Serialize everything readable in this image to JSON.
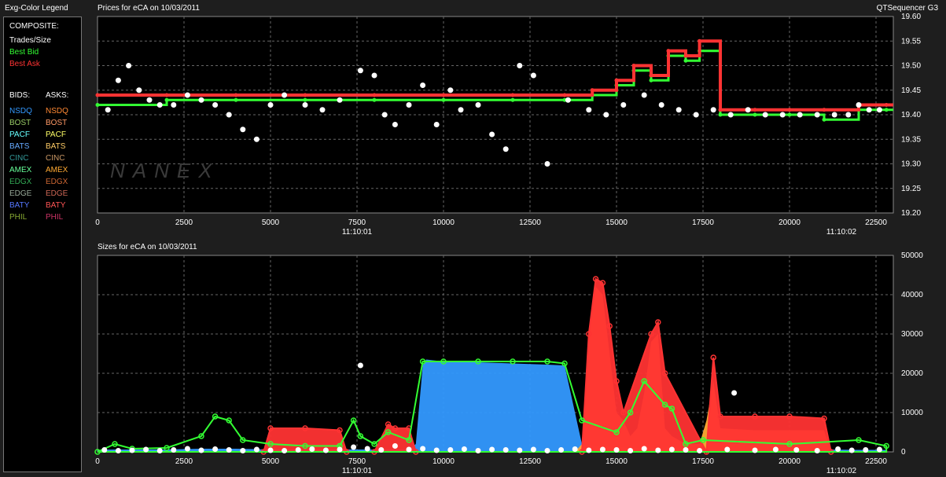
{
  "legend": {
    "title": "Exg-Color Legend",
    "composite_label": "COMPOSITE:",
    "composite": [
      {
        "label": "Trades/Size",
        "color": "#ffffff"
      },
      {
        "label": "Best Bid",
        "color": "#33ff33"
      },
      {
        "label": "Best Ask",
        "color": "#ff3333"
      }
    ],
    "bids_label": "BIDS:",
    "asks_label": "ASKS:",
    "bids": [
      {
        "label": "NSDQ",
        "color": "#3399ff"
      },
      {
        "label": "BOST",
        "color": "#99cc66"
      },
      {
        "label": "PACF",
        "color": "#66ffff"
      },
      {
        "label": "BATS",
        "color": "#66aaff"
      },
      {
        "label": "CINC",
        "color": "#339999"
      },
      {
        "label": "AMEX",
        "color": "#66ff99"
      },
      {
        "label": "EDGX",
        "color": "#33aa55"
      },
      {
        "label": "EDGE",
        "color": "#99aa99"
      },
      {
        "label": "BATY",
        "color": "#5577ff"
      },
      {
        "label": "PHIL",
        "color": "#88aa33"
      }
    ],
    "asks": [
      {
        "label": "NSDQ",
        "color": "#ff8833"
      },
      {
        "label": "BOST",
        "color": "#ff9966"
      },
      {
        "label": "PACF",
        "color": "#ffff66"
      },
      {
        "label": "BATS",
        "color": "#ffcc66"
      },
      {
        "label": "CINC",
        "color": "#cc9966"
      },
      {
        "label": "AMEX",
        "color": "#ffaa33"
      },
      {
        "label": "EDGX",
        "color": "#cc6633"
      },
      {
        "label": "EDGE",
        "color": "#cc6655"
      },
      {
        "label": "BATY",
        "color": "#ff5555"
      },
      {
        "label": "PHIL",
        "color": "#cc3366"
      }
    ]
  },
  "app_title": "QTSequencer G3",
  "watermark": "NANEX",
  "chart_data": [
    {
      "type": "scatter",
      "title": "Prices for  eCA  on 10/03/2011",
      "xlim": [
        0,
        23000
      ],
      "ylim": [
        19.2,
        19.6
      ],
      "x_ticks": [
        0,
        2500,
        5000,
        7500,
        10000,
        12500,
        15000,
        17500,
        20000,
        22500
      ],
      "y_ticks": [
        "19.20",
        "19.25",
        "19.30",
        "19.35",
        "19.40",
        "19.45",
        "19.50",
        "19.55",
        "19.60"
      ],
      "time_labels": [
        {
          "x": 7500,
          "text": "11:10:01"
        },
        {
          "x": 21500,
          "text": "11:10:02"
        }
      ],
      "grid": true,
      "series": [
        {
          "name": "Trades/Size",
          "color": "#ffffff",
          "x": [
            300,
            600,
            900,
            1200,
            1500,
            1800,
            2200,
            2600,
            3000,
            3400,
            3800,
            4200,
            4600,
            5000,
            5400,
            6000,
            6500,
            7000,
            7600,
            8000,
            8300,
            8600,
            9000,
            9400,
            9800,
            10200,
            10500,
            11000,
            11400,
            11800,
            12200,
            12600,
            13000,
            13600,
            14200,
            14700,
            15200,
            15800,
            16300,
            16800,
            17300,
            17800,
            18300,
            18800,
            19300,
            19800,
            20300,
            20800,
            21300,
            21700,
            22000,
            22300,
            22600
          ],
          "y": [
            19.41,
            19.47,
            19.5,
            19.45,
            19.43,
            19.42,
            19.42,
            19.44,
            19.43,
            19.42,
            19.4,
            19.37,
            19.35,
            19.42,
            19.44,
            19.42,
            19.41,
            19.43,
            19.49,
            19.48,
            19.4,
            19.38,
            19.42,
            19.46,
            19.38,
            19.45,
            19.41,
            19.42,
            19.36,
            19.33,
            19.5,
            19.48,
            19.3,
            19.43,
            19.41,
            19.4,
            19.42,
            19.44,
            19.42,
            19.41,
            19.4,
            19.41,
            19.4,
            19.41,
            19.4,
            19.4,
            19.4,
            19.4,
            19.4,
            19.4,
            19.42,
            19.41,
            19.41
          ]
        },
        {
          "name": "Best Bid",
          "color": "#33ff33",
          "x": [
            0,
            2000,
            4000,
            6000,
            8000,
            10000,
            12000,
            13500,
            14300,
            15000,
            15500,
            16000,
            16500,
            17000,
            17400,
            18000,
            19000,
            20000,
            21000,
            22000,
            22800
          ],
          "y": [
            19.42,
            19.43,
            19.43,
            19.43,
            19.43,
            19.43,
            19.43,
            19.43,
            19.44,
            19.46,
            19.49,
            19.47,
            19.52,
            19.51,
            19.53,
            19.4,
            19.4,
            19.4,
            19.39,
            19.41,
            19.41
          ]
        },
        {
          "name": "Best Ask",
          "color": "#ff3333",
          "x": [
            0,
            2000,
            4000,
            6000,
            8000,
            10000,
            12000,
            13500,
            14300,
            15000,
            15500,
            16000,
            16500,
            17000,
            17400,
            18000,
            19000,
            20000,
            21000,
            22000,
            22800
          ],
          "y": [
            19.44,
            19.44,
            19.44,
            19.44,
            19.44,
            19.44,
            19.44,
            19.44,
            19.45,
            19.47,
            19.5,
            19.48,
            19.53,
            19.52,
            19.55,
            19.41,
            19.41,
            19.41,
            19.41,
            19.42,
            19.42
          ]
        }
      ]
    },
    {
      "type": "area",
      "title": "Sizes for  eCA  on 10/03/2011",
      "xlim": [
        0,
        23000
      ],
      "ylim": [
        0,
        50000
      ],
      "x_ticks": [
        0,
        2500,
        5000,
        7500,
        10000,
        12500,
        15000,
        17500,
        20000,
        22500
      ],
      "y_ticks": [
        "0",
        "10000",
        "20000",
        "30000",
        "40000",
        "50000"
      ],
      "time_labels": [
        {
          "x": 7500,
          "text": "11:10:01"
        },
        {
          "x": 21500,
          "text": "11:10:02"
        }
      ],
      "grid": true,
      "series": [
        {
          "name": "NSDQ",
          "color": "#3399ff",
          "x": [
            0,
            500,
            1000,
            2000,
            3000,
            4000,
            5000,
            6000,
            7000,
            8000,
            9000,
            9200,
            9400,
            9500,
            10000,
            11000,
            12000,
            13000,
            13500,
            14000,
            14500,
            15000,
            16000,
            17000,
            18000,
            19000,
            20000,
            21000,
            22000,
            22800
          ],
          "y": [
            500,
            600,
            600,
            600,
            800,
            800,
            600,
            600,
            600,
            600,
            600,
            2000,
            22000,
            23500,
            23000,
            22800,
            22500,
            22200,
            22000,
            2000,
            1500,
            1200,
            1000,
            800,
            800,
            600,
            600,
            600,
            500,
            500
          ]
        },
        {
          "name": "AMEX",
          "color": "#ffaa33",
          "x": [
            13800,
            14000,
            14200,
            14400,
            14600,
            14800,
            15000,
            15200,
            15400,
            15600,
            15800,
            16000,
            16200,
            16400,
            16600,
            16800,
            17000,
            17400,
            17600,
            17800,
            18000,
            19000,
            20000,
            21000,
            21200
          ],
          "y": [
            0,
            2000,
            30000,
            42000,
            40000,
            25000,
            10000,
            8000,
            4000,
            6000,
            15000,
            28000,
            30000,
            6000,
            4000,
            3000,
            2000,
            2000,
            8000,
            18000,
            6000,
            5500,
            5500,
            5500,
            0
          ]
        },
        {
          "name": "Best Ask",
          "color": "#ff3333",
          "x": [
            4800,
            5000,
            6000,
            7000,
            7200,
            8000,
            8400,
            8600,
            9000,
            9200,
            14000,
            14200,
            14400,
            14600,
            14800,
            15000,
            15200,
            16000,
            16200,
            16400,
            17600,
            17800,
            18000,
            19000,
            20000,
            21000,
            21200
          ],
          "y": [
            0,
            6000,
            6000,
            5500,
            0,
            0,
            7000,
            6000,
            6000,
            0,
            0,
            30000,
            44000,
            43000,
            32000,
            18000,
            10000,
            30000,
            33000,
            20000,
            0,
            24000,
            9000,
            9000,
            9000,
            8500,
            0
          ]
        },
        {
          "name": "Best Bid",
          "color": "#33ff33",
          "x": [
            0,
            500,
            1000,
            2000,
            3000,
            3400,
            3800,
            4200,
            5000,
            6000,
            7000,
            7400,
            7600,
            8000,
            8400,
            9000,
            9400,
            10000,
            11000,
            12000,
            13000,
            13500,
            14000,
            15000,
            15400,
            15800,
            16400,
            16600,
            17000,
            17500,
            20000,
            22000,
            22800
          ],
          "y": [
            0,
            2000,
            800,
            1000,
            4000,
            9000,
            8000,
            3000,
            2000,
            1500,
            1500,
            8000,
            4000,
            2000,
            5000,
            3000,
            23000,
            23000,
            23000,
            23000,
            23000,
            22500,
            8000,
            5000,
            10000,
            18000,
            12000,
            11000,
            2000,
            3000,
            2000,
            3000,
            1500
          ]
        },
        {
          "name": "Trades/Size",
          "color": "#ffffff",
          "x": [
            200,
            600,
            1000,
            1400,
            1800,
            2200,
            2600,
            3000,
            3400,
            3800,
            4200,
            4600,
            5000,
            5400,
            5800,
            6200,
            6600,
            7000,
            7400,
            7600,
            7800,
            8200,
            8600,
            9000,
            9400,
            9800,
            10200,
            10600,
            11000,
            11400,
            11800,
            12200,
            12600,
            13000,
            13400,
            13800,
            14200,
            14600,
            15000,
            15400,
            15800,
            16200,
            16600,
            17000,
            17400,
            18200,
            18400,
            19000,
            19600,
            20200,
            20800,
            21400,
            21800,
            22200,
            22600
          ],
          "y": [
            500,
            300,
            400,
            600,
            300,
            500,
            800,
            400,
            700,
            500,
            300,
            600,
            400,
            300,
            500,
            700,
            400,
            600,
            1200,
            22000,
            800,
            500,
            1500,
            600,
            800,
            400,
            500,
            700,
            300,
            600,
            500,
            400,
            600,
            300,
            500,
            700,
            400,
            600,
            500,
            300,
            800,
            400,
            600,
            500,
            300,
            600,
            15000,
            400,
            600,
            500,
            300,
            700,
            400,
            500,
            600
          ]
        }
      ]
    }
  ]
}
